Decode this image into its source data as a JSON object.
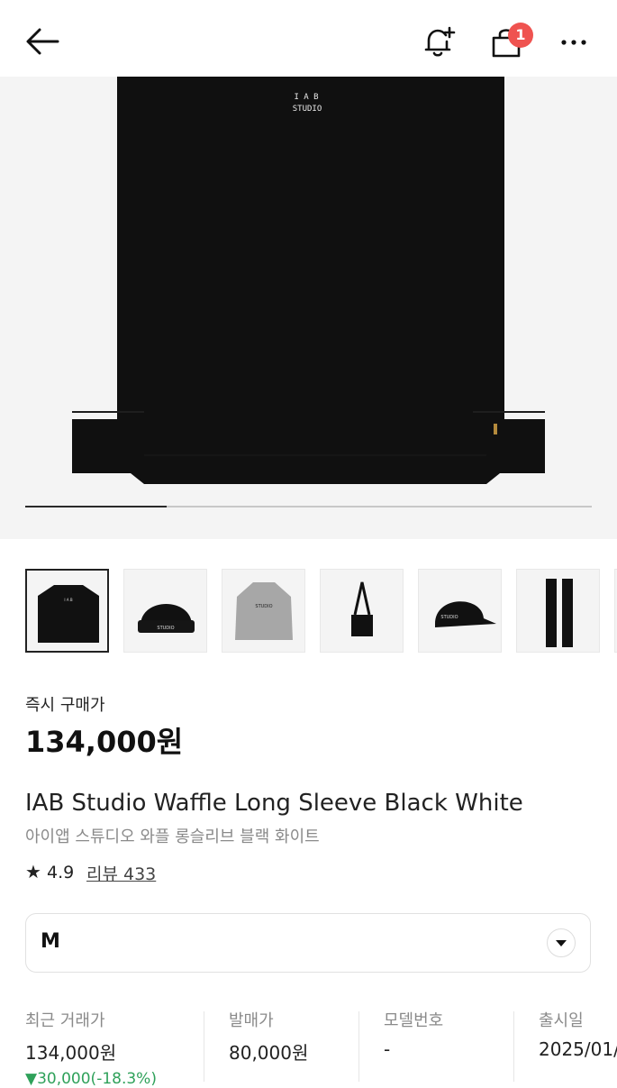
{
  "header": {
    "icons": [
      "back-arrow-icon",
      "bell-plus-icon",
      "shopping-bag-icon",
      "more-icon"
    ],
    "cart_badge": "1"
  },
  "hero": {
    "logo_line1": "I A B",
    "logo_line2": "STUDIO",
    "slide_progress": 0.25
  },
  "thumbnails": [
    {
      "name": "thumb-sweatshirt",
      "logo": "I A B",
      "selected": true
    },
    {
      "name": "thumb-beanie",
      "logo": "STUDIO"
    },
    {
      "name": "thumb-jacket",
      "logo": "STUDIO"
    },
    {
      "name": "thumb-bag"
    },
    {
      "name": "thumb-cap",
      "logo": "STUDIO"
    },
    {
      "name": "thumb-scarf"
    }
  ],
  "buy": {
    "label": "즉시 구매가",
    "price": "134,000원"
  },
  "product": {
    "name_en": "IAB Studio Waffle Long Sleeve Black White",
    "name_ko": "아이앱 스튜디오 와플 롱슬리브 블랙 화이트",
    "star": "★",
    "rating": "4.9",
    "review": "리뷰 433"
  },
  "size": {
    "selected": "M"
  },
  "stats": [
    {
      "label": "최근 거래가",
      "value": "134,000원",
      "delta": "▼30,000(-18.3%)"
    },
    {
      "label": "발매가",
      "value": "80,000원"
    },
    {
      "label": "모델번호",
      "value": "-"
    },
    {
      "label": "출시일",
      "value": "2025/01/"
    }
  ],
  "colors": {
    "badge": "#ef5350",
    "delta_down": "#2fa15a"
  }
}
